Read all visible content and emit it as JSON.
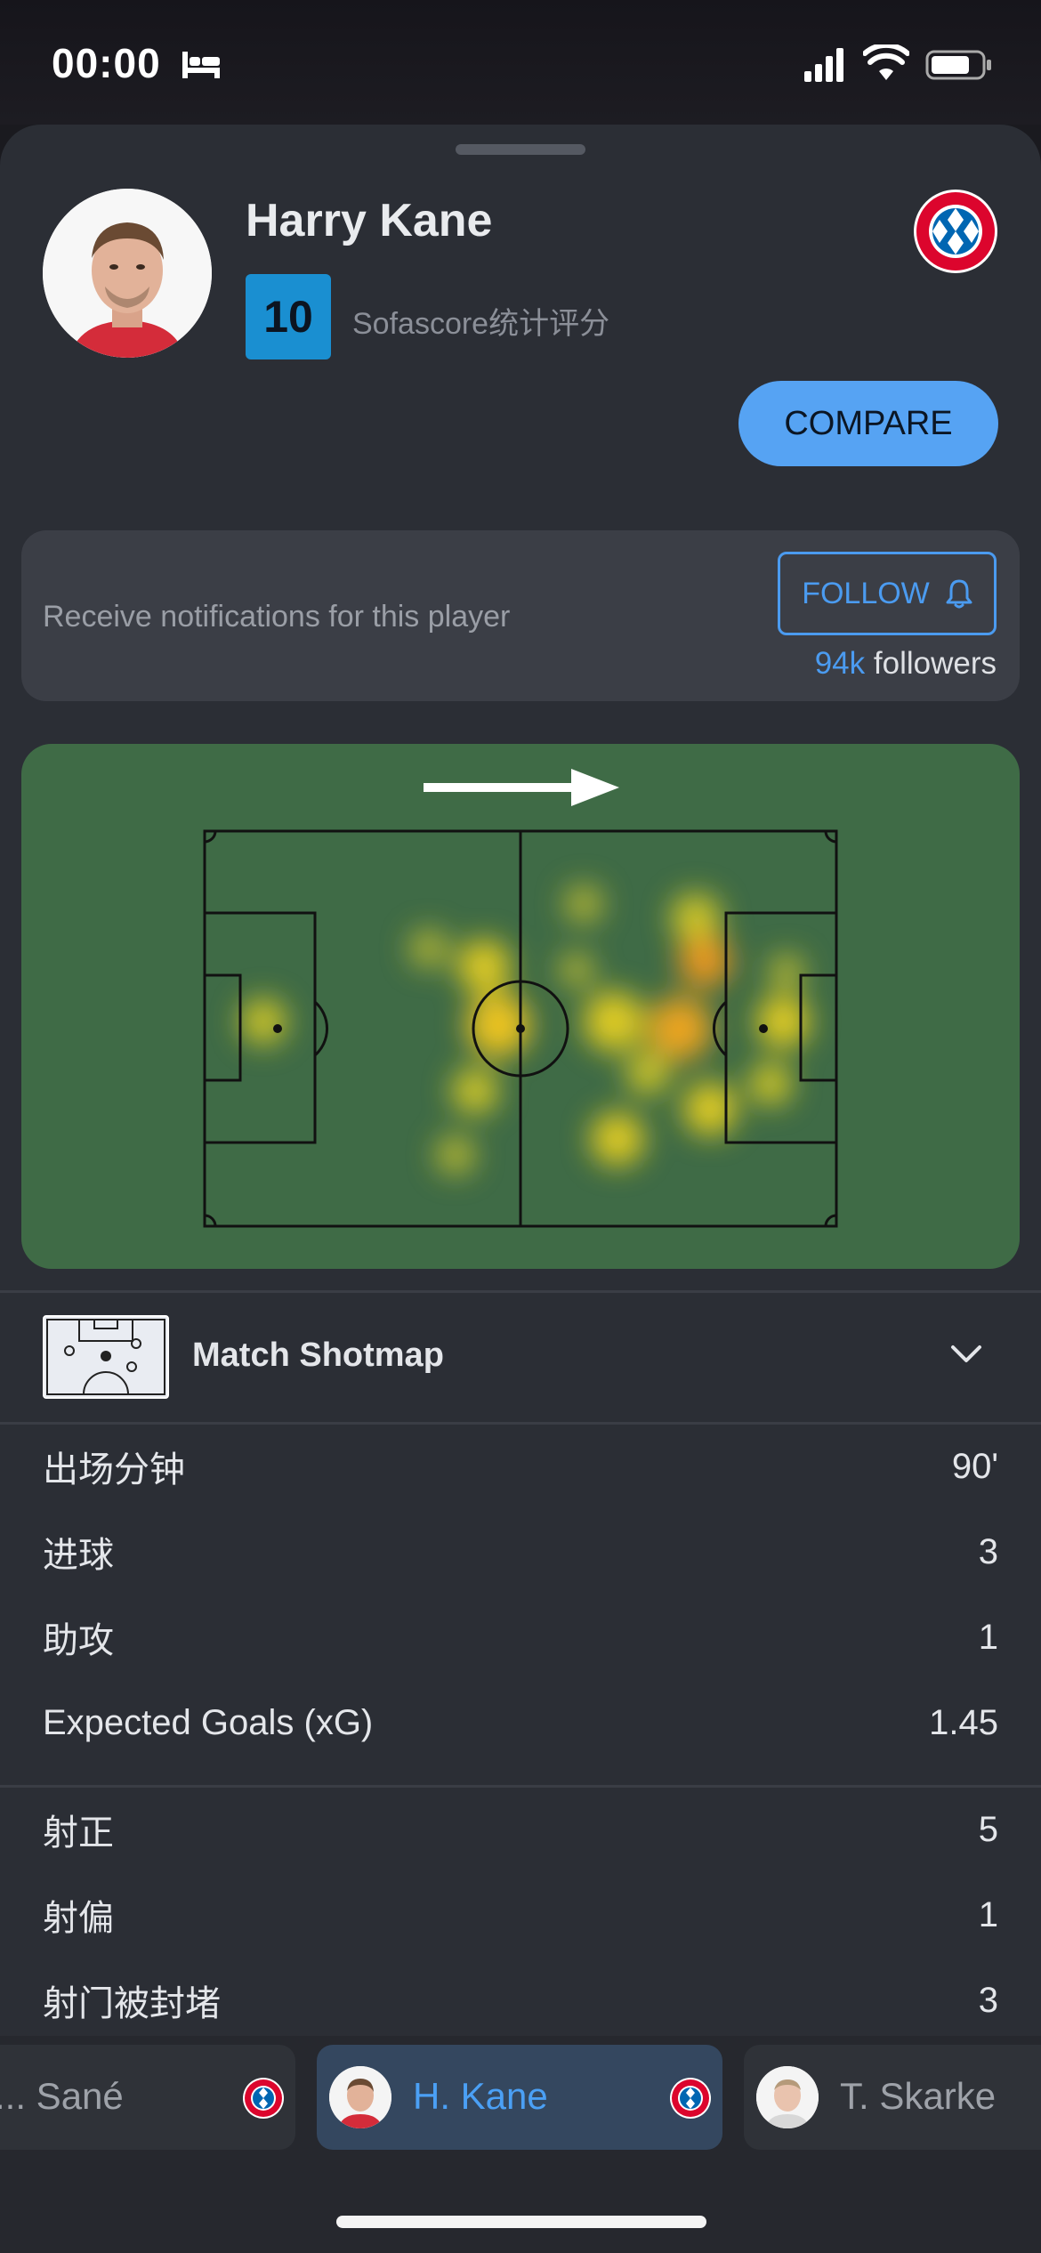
{
  "status_bar": {
    "time": "00:00"
  },
  "player": {
    "name": "Harry Kane",
    "rating": "10",
    "rating_label": "Sofascore统计评分",
    "club": "FC Bayern München",
    "compare_label": "COMPARE"
  },
  "notifications": {
    "text": "Receive notifications for this player",
    "follow_label": "FOLLOW",
    "followers_count": "94k",
    "followers_label": "followers"
  },
  "heatmap": {
    "direction": "attacking-right"
  },
  "shotmap": {
    "label": "Match Shotmap"
  },
  "stats_group1": [
    {
      "label": "出场分钟",
      "value": "90'"
    },
    {
      "label": "进球",
      "value": "3"
    },
    {
      "label": "助攻",
      "value": "1"
    },
    {
      "label": "Expected Goals (xG)",
      "value": "1.45"
    }
  ],
  "stats_group2": [
    {
      "label": "射正",
      "value": "5"
    },
    {
      "label": "射偏",
      "value": "1"
    },
    {
      "label": "射门被封堵",
      "value": "3"
    }
  ],
  "player_tabs": [
    {
      "label": "... Sané",
      "active": false
    },
    {
      "label": "H. Kane",
      "active": true
    },
    {
      "label": "T. Skarke",
      "active": false
    }
  ],
  "colors": {
    "accent": "#4b9bf0",
    "rating_bg": "#1a8fd1",
    "pitch": "#3f6b46",
    "sheet_bg": "#2b2e35"
  }
}
